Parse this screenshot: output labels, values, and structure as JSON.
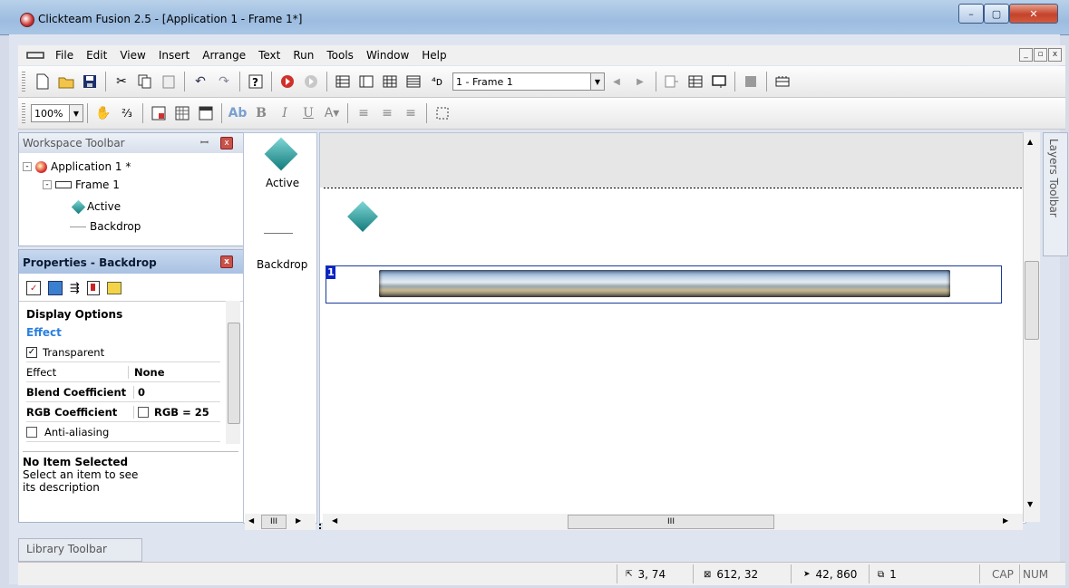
{
  "window": {
    "title": "Clickteam Fusion 2.5 - [Application 1 - Frame 1*]",
    "minimize": "–",
    "maximize": "▢",
    "close": "✕"
  },
  "menu": [
    "File",
    "Edit",
    "View",
    "Insert",
    "Arrange",
    "Text",
    "Run",
    "Tools",
    "Window",
    "Help"
  ],
  "toolbar": {
    "frame_select": "1 - Frame 1",
    "zoom": "100%",
    "bold": "B",
    "italic": "I",
    "underline": "U"
  },
  "workspace": {
    "title": "Workspace Toolbar",
    "tree": {
      "application": "Application 1 *",
      "frame": "Frame 1",
      "active": "Active",
      "backdrop": "Backdrop"
    }
  },
  "properties": {
    "title": "Properties - Backdrop",
    "section": "Display Options",
    "subsection": "Effect",
    "transparent_label": "Transparent",
    "rows": [
      {
        "label": "Effect",
        "value": "None"
      },
      {
        "label": "Blend Coefficient",
        "value": "0"
      },
      {
        "label": "RGB Coefficient",
        "value": "RGB = 25"
      }
    ],
    "antialias_label": "Anti-aliasing",
    "desc_title": "No Item Selected",
    "desc_text": "Select an item to see its description"
  },
  "object_list": {
    "active": "Active",
    "backdrop": "Backdrop"
  },
  "editor": {
    "layer_marker": "1"
  },
  "layers_tab": "Layers Toolbar",
  "library_tab": "Library Toolbar",
  "scroll": {
    "left_thumb": "III",
    "main_thumb": "III"
  },
  "status": {
    "pos": "3, 74",
    "size": "612, 32",
    "mouse": "42, 860",
    "layer": "1",
    "cap": "CAP",
    "num": "NUM"
  },
  "colors": {
    "diamond": "#137b7b",
    "selection": "#1a3a9a"
  }
}
